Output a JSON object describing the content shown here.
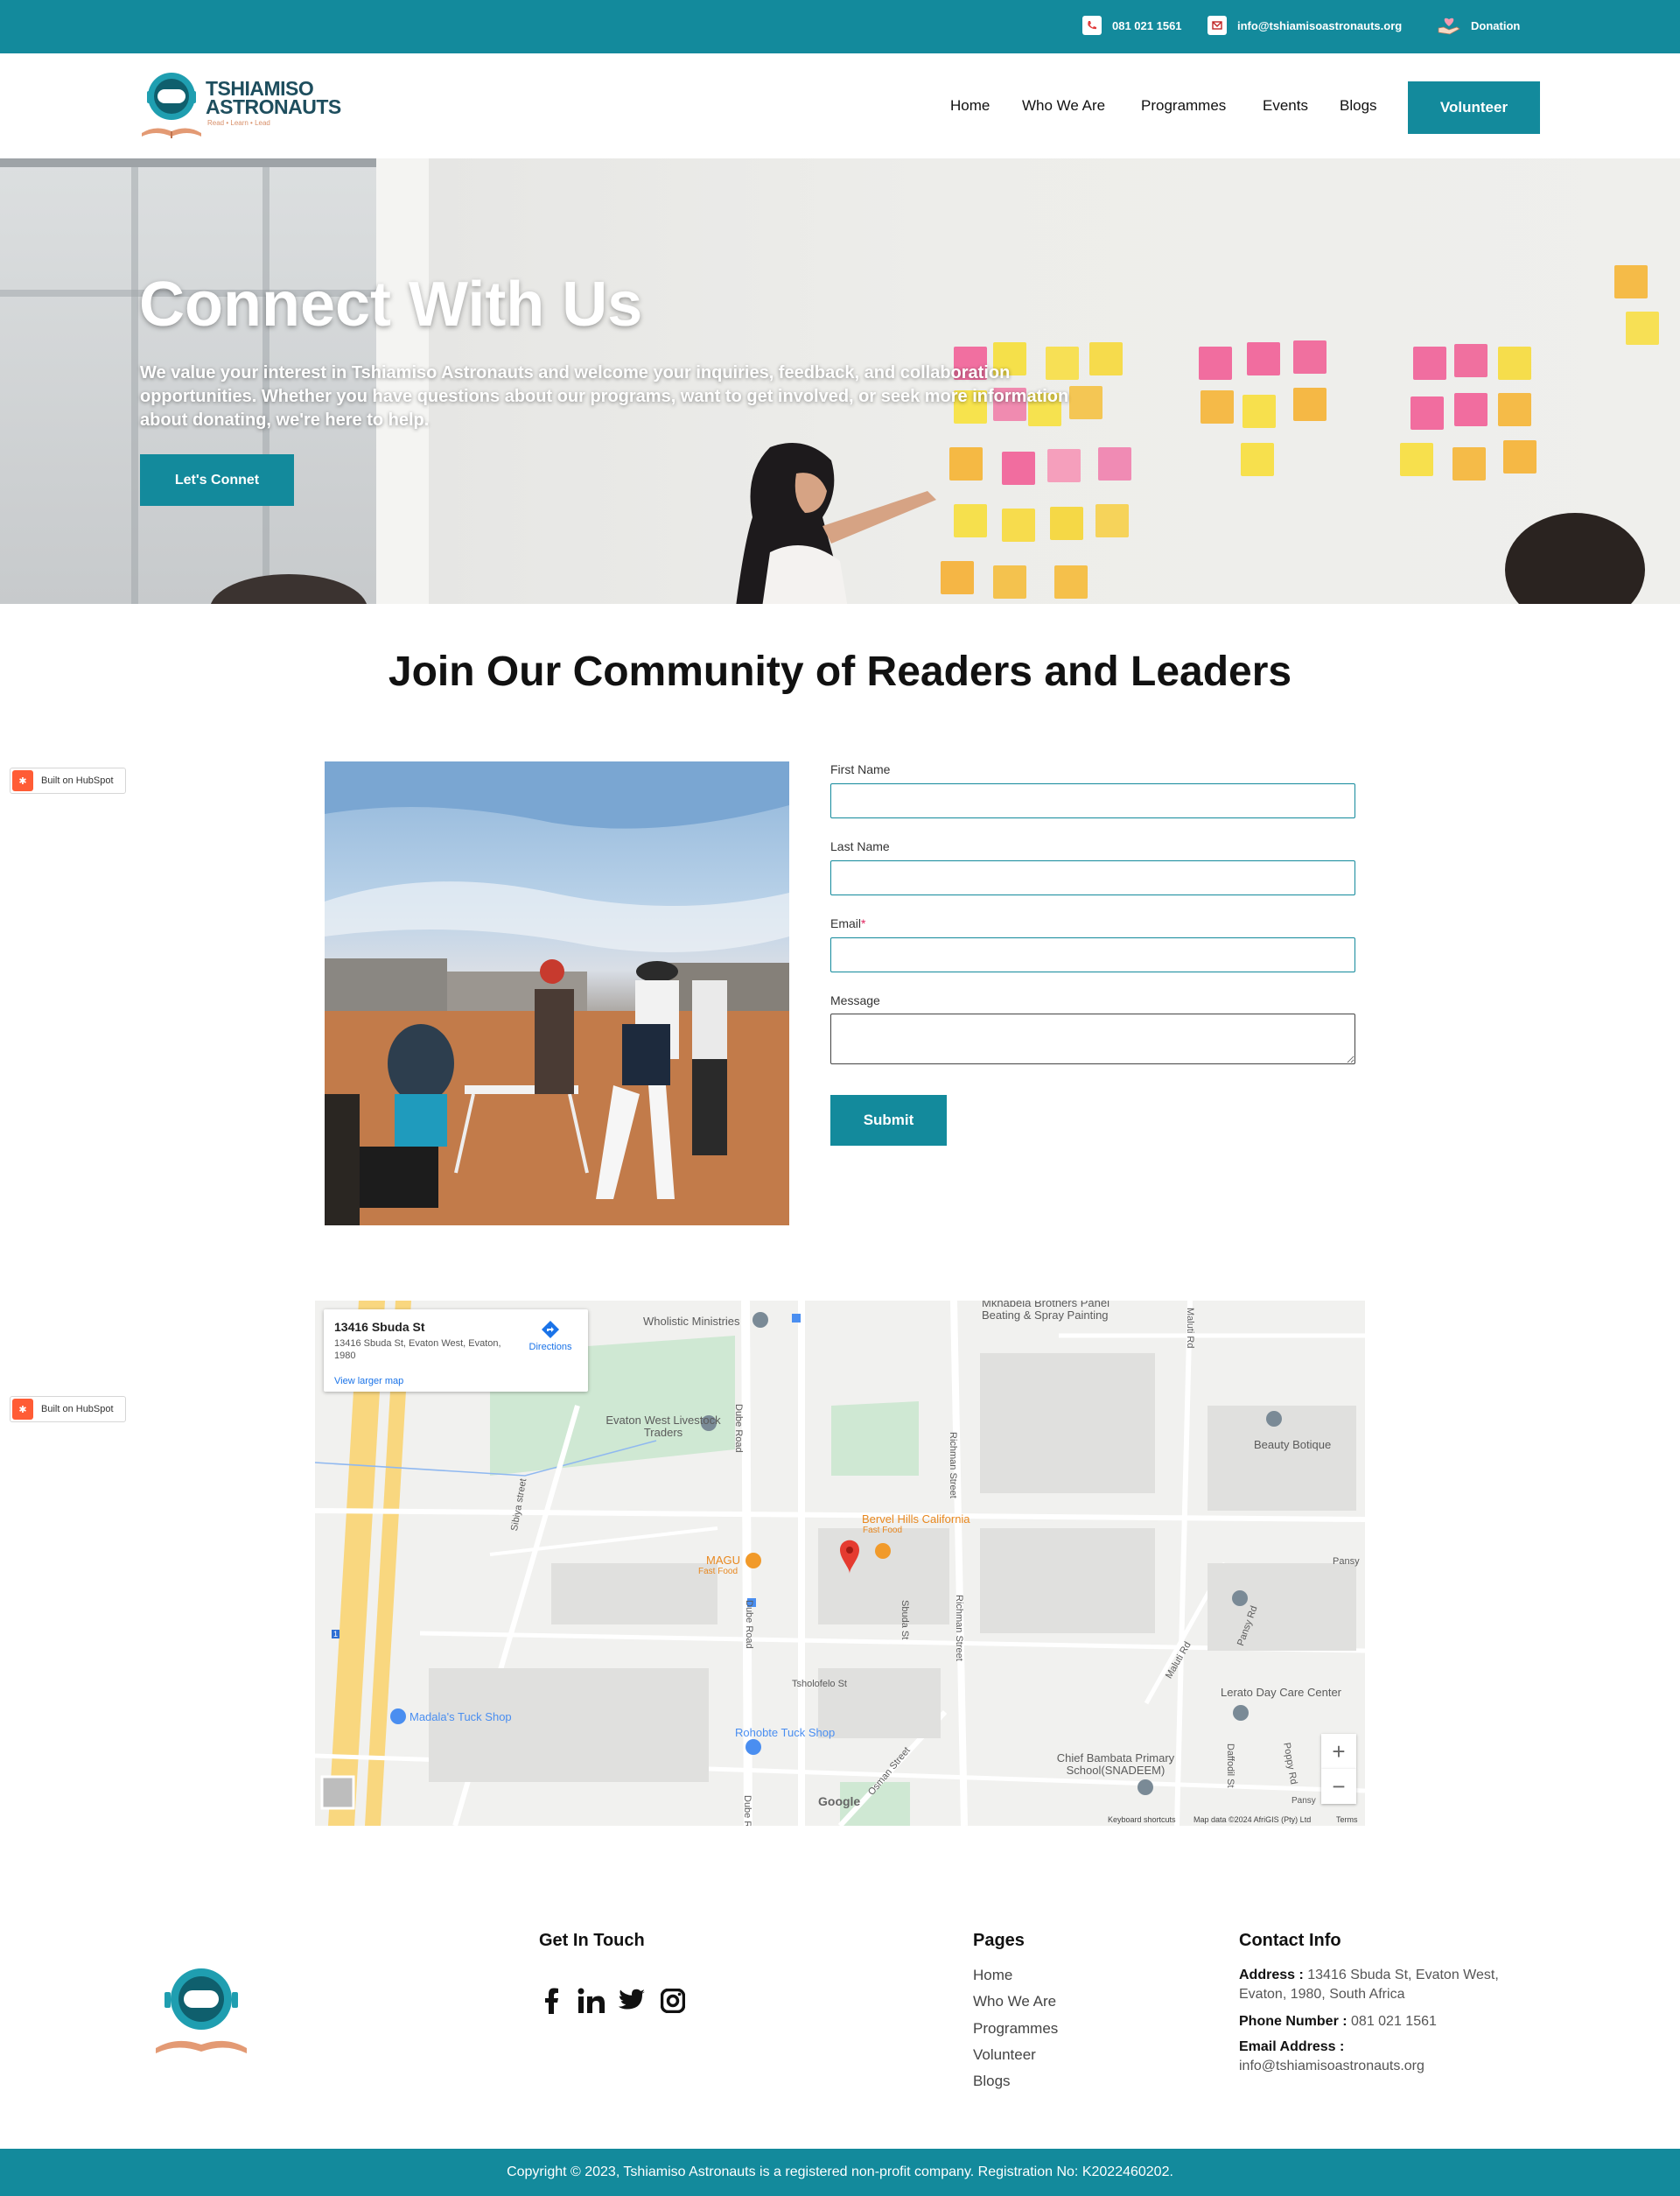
{
  "topbar": {
    "phone": "081 021 1561",
    "email": "info@tshiamisoastronauts.org",
    "donation": "Donation"
  },
  "brand": {
    "name_line1": "TSHIAMISO",
    "name_line2": "ASTRONAUTS",
    "tagline": "Read • Learn • Lead"
  },
  "nav": {
    "items": [
      "Home",
      "Who We Are",
      "Programmes",
      "Events",
      "Blogs"
    ],
    "cta": "Volunteer"
  },
  "hero": {
    "title": "Connect With Us",
    "subtitle": "We value your interest in Tshiamiso Astronauts and welcome your inquiries, feedback, and collaboration opportunities. Whether you have questions about our programs, want to get involved, or seek more information about donating, we're here to help.",
    "button": "Let's Connet"
  },
  "section": {
    "title": "Join Our Community of Readers and Leaders"
  },
  "hubspot": {
    "label": "Built on HubSpot"
  },
  "form": {
    "first_name": "First Name",
    "last_name": "Last Name",
    "email": "Email",
    "email_required": "*",
    "message": "Message",
    "submit": "Submit"
  },
  "map": {
    "place": "13416 Sbuda St",
    "address": "13416 Sbuda St, Evaton West, Evaton, 1980",
    "directions": "Directions",
    "view_larger": "View larger map",
    "labels": {
      "wholistic": "Wholistic Ministries",
      "mkhabela": "Mkhabela Brothers Panel Beating & Spray Painting",
      "maluti": "Maluti Rd",
      "evaton": "Evaton West Livestock Traders",
      "beauty": "Beauty Botique",
      "dube1": "Dube Road",
      "dube2": "Dube Road",
      "dube3": "Dube R",
      "richman1": "Richman Street",
      "richman2": "Richman Street",
      "sibiya": "Sibiya street",
      "bervel": "Bervel Hills California",
      "bervel_type": "Fast Food",
      "magu": "MAGU",
      "magu_type": "Fast Food",
      "pansy": "Pansy",
      "pansy_rd": "Pansy Rd",
      "sbuda": "Sbuda St",
      "tsholofelo": "Tsholofelo St",
      "maluti2": "Maluti Rd",
      "lerato": "Lerato Day Care Center",
      "madala": "Madala's Tuck Shop",
      "rohobte": "Rohobte Tuck Shop",
      "osman": "Osman Street",
      "chief": "Chief Bambata Primary School(SNADEEM)",
      "daffodil": "Daffodil St",
      "poppy": "Poppy Rd",
      "pansy2": "Pansy",
      "google": "Google",
      "route": "1"
    },
    "footer": {
      "shortcuts": "Keyboard shortcuts",
      "data": "Map data ©2024 AfriGIS (Pty) Ltd",
      "terms": "Terms"
    }
  },
  "footer": {
    "get_in_touch": "Get In Touch",
    "pages_heading": "Pages",
    "pages": [
      "Home",
      "Who We Are",
      "Programmes",
      "Volunteer",
      "Blogs"
    ],
    "contact_heading": "Contact Info",
    "address_label": "Address :",
    "address": "13416 Sbuda St, Evaton West, Evaton, 1980, South Africa",
    "phone_label": "Phone Number :",
    "phone": "081 021 1561",
    "email_label": "Email Address :",
    "email": "info@tshiamisoastronauts.org",
    "copyright": "Copyright © 2023, Tshiamiso Astronauts is a registered non-profit company. Registration No: K2022460202."
  },
  "colors": {
    "brand_teal": "#138a9c",
    "dark_navy": "#1e4e5e",
    "hubspot_orange": "#ff5c35"
  }
}
